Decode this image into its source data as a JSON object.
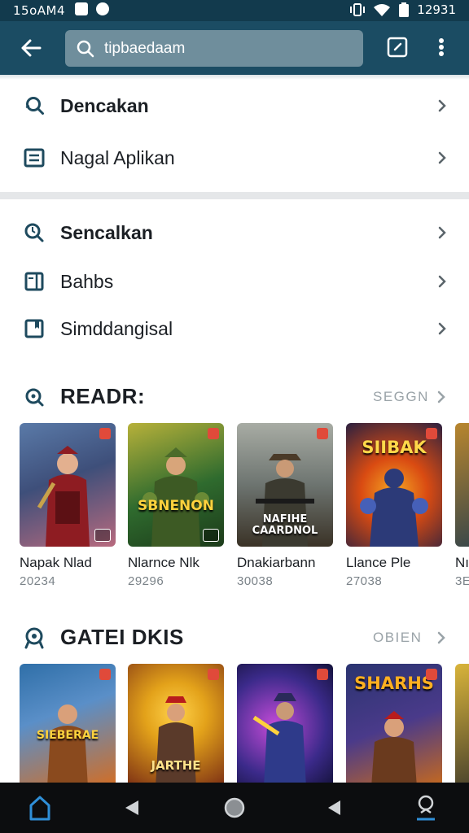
{
  "status_bar": {
    "time": "15oAM4",
    "right_time": "12931"
  },
  "app_bar": {
    "search_value": "tipbaedaam"
  },
  "menu_group_1": [
    {
      "label": "Dencakan",
      "icon": "search-icon",
      "bold": true
    },
    {
      "label": "Nagal Aplikan",
      "icon": "list-icon",
      "bold": false
    }
  ],
  "menu_group_2": [
    {
      "label": "Sencalkan",
      "icon": "search-icon",
      "bold": true
    },
    {
      "label": "Bahbs",
      "icon": "book-icon",
      "bold": false
    },
    {
      "label": "Simddangisal",
      "icon": "bookmark-icon",
      "bold": false
    }
  ],
  "section_1": {
    "title": "READR:",
    "more": "SEGGN",
    "cards": [
      {
        "name": "Napak Nlad",
        "count": "20234",
        "cover_text": "",
        "colors": [
          "#3e4f7a",
          "#b86a7e"
        ]
      },
      {
        "name": "Nlarnce Nlk",
        "count": "29296",
        "cover_text": "SBNENON",
        "colors": [
          "#2f6b2e",
          "#b7b13a"
        ]
      },
      {
        "name": "Dnakiarbann",
        "count": "30038",
        "cover_text": "NAFIHE CAARDNOL",
        "colors": [
          "#6d7470",
          "#3a3226"
        ]
      },
      {
        "name": "Llance Ple",
        "count": "27038",
        "cover_text": "SIIBAK",
        "colors": [
          "#d94b12",
          "#2a2040"
        ]
      },
      {
        "name": "Nı",
        "count": "3E",
        "cover_text": "",
        "colors": [
          "#1f3a4f",
          "#b8862e"
        ]
      }
    ]
  },
  "section_2": {
    "title": "GATEI DKIS",
    "more": "OBIEN",
    "cards": [
      {
        "cover_text": "SIEBERAE",
        "colors": [
          "#2f6fa8",
          "#d46d22"
        ]
      },
      {
        "cover_text": "JARTHE",
        "colors": [
          "#e3a21a",
          "#7a2d14"
        ]
      },
      {
        "cover_text": "",
        "colors": [
          "#3b2a8a",
          "#c44bd8"
        ]
      },
      {
        "cover_text": "SHARHS",
        "colors": [
          "#2a3470",
          "#c76a1d"
        ]
      },
      {
        "cover_text": "",
        "colors": [
          "#2a2a2a",
          "#d9b43a"
        ]
      }
    ]
  },
  "colors": {
    "app_bar": "#1b4c63",
    "status_bar": "#123a4d",
    "nav_bar": "#0c0d0f",
    "icon_teal": "#1e4a5e"
  }
}
